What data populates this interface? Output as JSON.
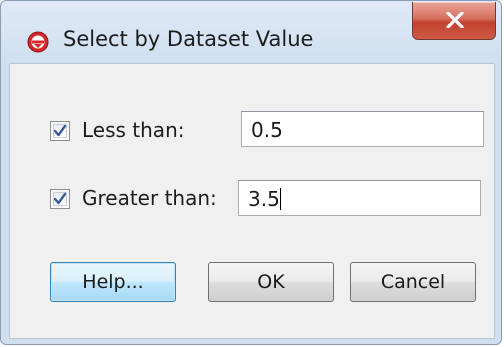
{
  "window": {
    "title": "Select by Dataset Value",
    "app_icon": "red-circle-app-icon",
    "close_icon": "close-x-icon"
  },
  "form": {
    "less_than": {
      "checked": true,
      "label": "Less than:",
      "value": "0.5"
    },
    "greater_than": {
      "checked": true,
      "label": "Greater than:",
      "value": "3.5"
    }
  },
  "buttons": {
    "help": "Help...",
    "ok": "OK",
    "cancel": "Cancel"
  },
  "colors": {
    "close_button": "#c2412e",
    "default_button": "#bee6fd",
    "window_frame": "#cfdff0"
  }
}
